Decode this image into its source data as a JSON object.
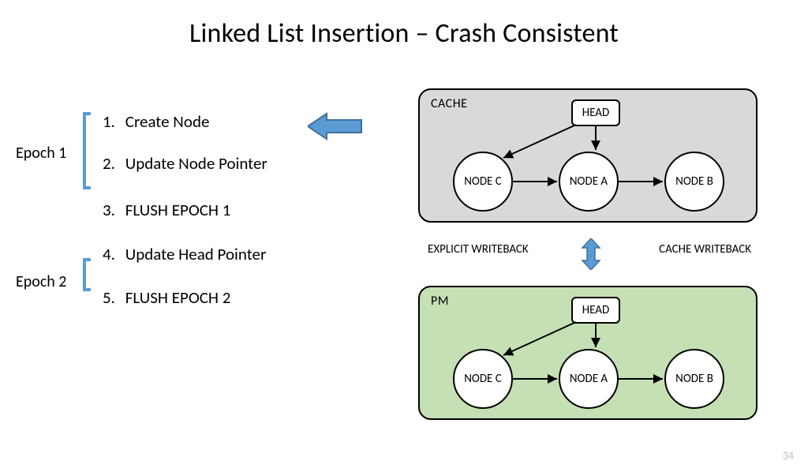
{
  "title": "Linked List Insertion – Crash Consistent",
  "slide_number": "34",
  "epochs": {
    "e1_label": "Epoch 1",
    "e2_label": "Epoch 2"
  },
  "steps": {
    "s1_num": "1.",
    "s1": "Create Node",
    "s2_num": "2.",
    "s2": "Update Node Pointer",
    "s3_num": "3.",
    "s3": "FLUSH EPOCH 1",
    "s4_num": "4.",
    "s4": "Update Head Pointer",
    "s5_num": "5.",
    "s5": "FLUSH EPOCH 2"
  },
  "panels": {
    "cache_label": "CACHE",
    "pm_label": "PM",
    "head": "HEAD",
    "nodeC": "NODE C",
    "nodeA": "NODE A",
    "nodeB": "NODE B"
  },
  "writeback": {
    "explicit": "EXPLICIT WRITEBACK",
    "cache": "CACHE WRITEBACK"
  },
  "colors": {
    "blue": "#5b9bd5",
    "blue_dark": "#41719c",
    "cache_bg": "#d9d9d9",
    "pm_bg": "#c5e0b4"
  }
}
